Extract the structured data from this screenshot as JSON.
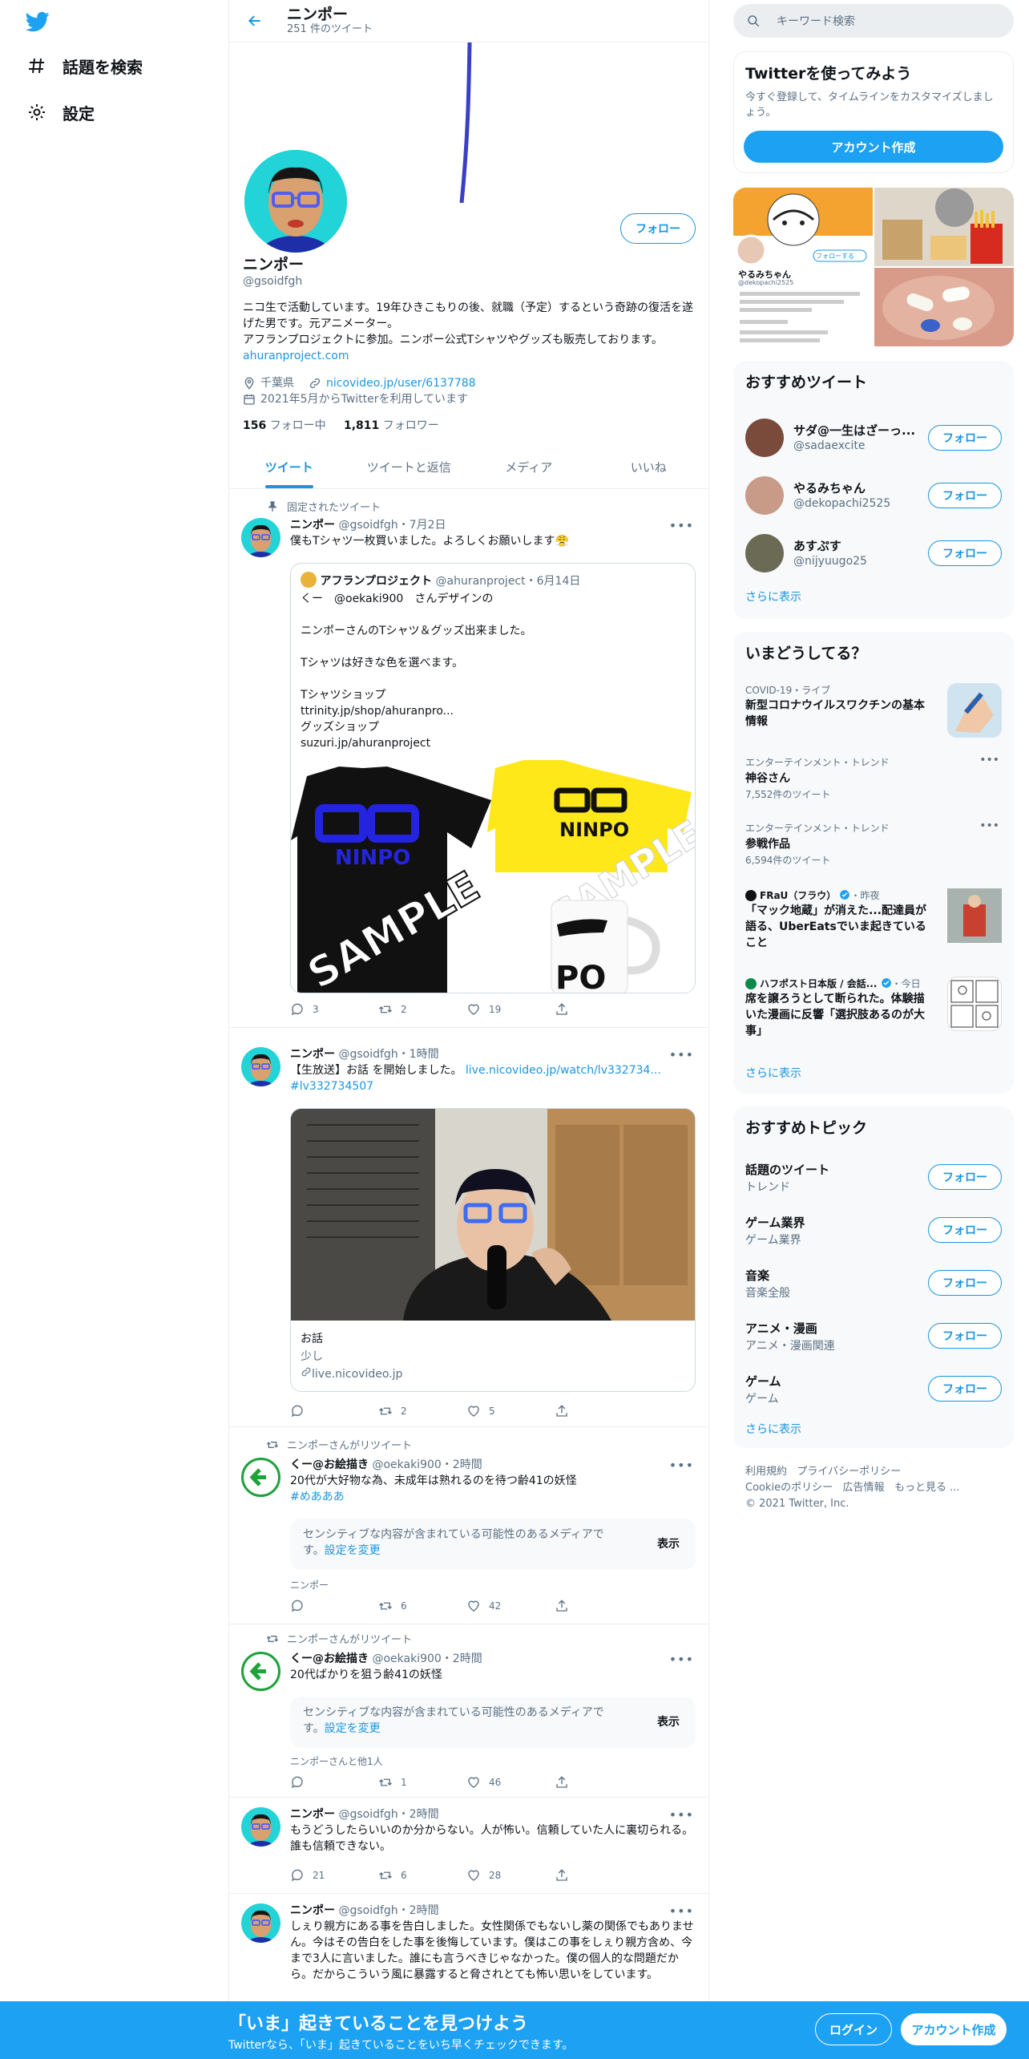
{
  "nav": {
    "explore_label": "話題を検索",
    "settings_label": "設定"
  },
  "header": {
    "name": "ニンポー",
    "tweet_count": "251 件のツイート"
  },
  "profile": {
    "name": "ニンポー",
    "handle": "@gsoidfgh",
    "follow_label": "フォロー",
    "bio": "ニコ生で活動しています。19年ひきこもりの後、就職（予定）するという奇跡の復活を遂げた男です。元アニメーター。\nアフランプロジェクトに参加。ニンポー公式Tシャツやグッズも販売しております。",
    "bio_link": "ahuranproject.com",
    "location": "千葉県",
    "website": "nicovideo.jp/user/6137788",
    "joined": "2021年5月からTwitterを利用しています",
    "following_count": "156",
    "following_label": "フォロー中",
    "followers_count": "1,811",
    "followers_label": "フォロワー"
  },
  "tabs": [
    "ツイート",
    "ツイートと返信",
    "メディア",
    "いいね"
  ],
  "tweets": [
    {
      "context": "固定されたツイート",
      "name": "ニンポー",
      "handle": "@gsoidfgh",
      "time": "・7月2日",
      "text": "僕もTシャツ一枚買いました。よろしくお願いします😤",
      "quote": {
        "name": "アフランプロジェクト",
        "handle": "@ahuranproject",
        "time": "・6月14日",
        "text": "くー　@oekaki900　さんデザインの\n\nニンポーさんのTシャツ＆グッズ出来ました。\n\nTシャツは好きな色を選べます。\n\nTシャツショップ\nttrinity.jp/shop/ahuranpro...\nグッズショップ\nsuzuri.jp/ahuranproject",
        "sample": "SAMPLE",
        "shirt_text": "NINPO",
        "mug_text": "PO"
      },
      "replies": "3",
      "retweets": "2",
      "likes": "19"
    },
    {
      "name": "ニンポー",
      "handle": "@gsoidfgh",
      "time": "・1時間",
      "text_prefix": "【生放送】お話 を開始しました。",
      "link": "live.nicovideo.jp/watch/lv332734...",
      "hashtag": "#lv332734507",
      "card_title": "お話",
      "card_desc": "少し",
      "card_domain": "live.nicovideo.jp",
      "replies": "",
      "retweets": "2",
      "likes": "5"
    },
    {
      "context": "ニンポーさんがリツイート",
      "name": "くー@お絵描き",
      "handle": "@oekaki900",
      "time": "・2時間",
      "text": "20代が大好物な為、未成年は熟れるのを待つ齢41の妖怪",
      "hashtag": "#めあああ",
      "sensitive": "センシティブな内容が含まれている可能性のあるメディアです。",
      "sensitive_link": "設定を変更",
      "show_label": "表示",
      "tagged": "ニンポー",
      "replies": "",
      "retweets": "6",
      "likes": "42"
    },
    {
      "context": "ニンポーさんがリツイート",
      "name": "くー@お絵描き",
      "handle": "@oekaki900",
      "time": "・2時間",
      "text": "20代ばかりを狙う齢41の妖怪",
      "sensitive": "センシティブな内容が含まれている可能性のあるメディアです。",
      "sensitive_link": "設定を変更",
      "show_label": "表示",
      "tagged": "ニンポーさんと他1人",
      "replies": "",
      "retweets": "1",
      "likes": "46"
    },
    {
      "name": "ニンポー",
      "handle": "@gsoidfgh",
      "time": "・2時間",
      "text": "もうどうしたらいいのか分からない。人が怖い。信頼していた人に裏切られる。誰も信頼できない。",
      "replies": "21",
      "retweets": "6",
      "likes": "28"
    },
    {
      "name": "ニンポー",
      "handle": "@gsoidfgh",
      "time": "・2時間",
      "text": "しぇり親方にある事を告白しました。女性関係でもないし薬の関係でもありません。今はその告白をした事を後悔しています。僕はこの事をしぇり親方含め、今まで3人に言いました。誰にも言うべきじゃなかった。僕の個人的な問題だから。だからこういう風に暴露すると脅されとても怖い思いをしています。"
    }
  ],
  "right": {
    "search_placeholder": "キーワード検索",
    "signup_card": {
      "title": "Twitterを使ってみよう",
      "desc": "今すぐ登録して、タイムラインをカスタマイズしましょう。",
      "button": "アカウント作成"
    },
    "media_preview": {
      "name": "やるみちゃん",
      "handle": "@dekopachi2525",
      "follow": "フォローする"
    },
    "recommended_title": "おすすめツイート",
    "recommended": [
      {
        "name": "サダ@一生はざーっ...",
        "handle": "@sadaexcite"
      },
      {
        "name": "やるみちゃん",
        "handle": "@dekopachi2525"
      },
      {
        "name": "あすぷす",
        "handle": "@nijyuugo25"
      }
    ],
    "follow_label": "フォロー",
    "show_more": "さらに表示",
    "trends_title": "いまどうしてる？",
    "trends": [
      {
        "meta": "COVID-19・ライブ",
        "title": "新型コロナウイルスワクチンの基本情報"
      },
      {
        "meta": "エンターテインメント・トレンド",
        "title": "神谷さん",
        "count": "7,552件のツイート"
      },
      {
        "meta": "エンターテインメント・トレンド",
        "title": "参戦作品",
        "count": "6,594件のツイート"
      },
      {
        "source": "FRaU（フラウ）",
        "time": "・昨夜",
        "title": "「マック地蔵」が消えた...配達員が語る、UberEatsでいま起きていること"
      },
      {
        "source": "ハフポスト日本版 / 会話...",
        "time": "・今日",
        "title": "席を譲ろうとして断られた。体験描いた漫画に反響「選択肢あるのが大事」"
      }
    ],
    "topics_title": "おすすめトピック",
    "topics": [
      {
        "title": "話題のツイート",
        "sub": "トレンド"
      },
      {
        "title": "ゲーム業界",
        "sub": "ゲーム業界"
      },
      {
        "title": "音楽",
        "sub": "音楽全般"
      },
      {
        "title": "アニメ・漫画",
        "sub": "アニメ・漫画関連"
      },
      {
        "title": "ゲーム",
        "sub": "ゲーム"
      }
    ],
    "footer": [
      "利用規約",
      "プライバシーポリシー",
      "Cookieのポリシー",
      "広告情報",
      "もっと見る ...",
      "© 2021 Twitter, Inc."
    ]
  },
  "bottom": {
    "title": "「いま」起きていることを見つけよう",
    "sub": "Twitterなら、「いま」起きていることをいち早くチェックできます。",
    "login": "ログイン",
    "signup": "アカウント作成"
  },
  "colors": {
    "accent": "#1b95e0",
    "bar": "#1da1f2",
    "avatar_bg": "#22d3d8"
  }
}
